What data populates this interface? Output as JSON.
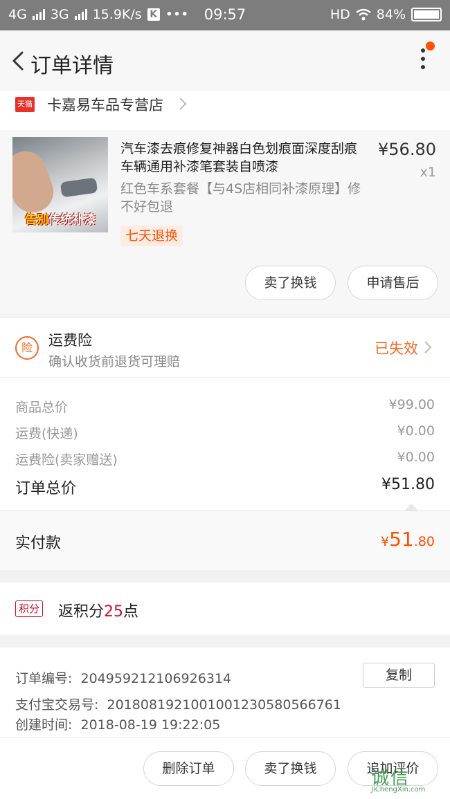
{
  "status_bar": {
    "network1": "4G",
    "network2": "3G",
    "speed": "15.9K/s",
    "k_icon": "K",
    "dots": "•••",
    "time": "09:57",
    "hd": "HD",
    "battery": "84%"
  },
  "header": {
    "title": "订单详情"
  },
  "store": {
    "badge": "天猫",
    "name": "卡嘉易车品专营店"
  },
  "product": {
    "image_banner_a": "告别",
    "image_banner_b": "传统补漆",
    "name": "汽车漆去痕修复神器白色划痕面深度刮痕车辆通用补漆笔套装自喷漆",
    "price": "¥56.80",
    "quantity": "x1",
    "sku": "红色车系套餐【与4S店相同补漆原理】修不好包退",
    "badge": "七天退换",
    "btn_sell": "卖了换钱",
    "btn_aftersale": "申请售后"
  },
  "insurance": {
    "icon_text": "险",
    "title": "运费险",
    "subtitle": "确认收货前退货可理赔",
    "status": "已失效"
  },
  "price": {
    "rows": [
      {
        "label": "商品总价",
        "value": "¥99.00"
      },
      {
        "label": "运费(快递)",
        "value": "¥0.00"
      },
      {
        "label": "运费险(卖家赠送)",
        "value": "¥0.00"
      }
    ],
    "total_label": "订单总价",
    "total_value": "¥51.80",
    "paid_label": "实付款",
    "paid_currency": "¥",
    "paid_int": "51",
    "paid_dec": ".80"
  },
  "points": {
    "tag": "积分",
    "text_prefix": "返积分",
    "count": "25",
    "text_suffix": "点"
  },
  "order_info": {
    "order_no_label": "订单编号:",
    "order_no": "204959212106926314",
    "copy_label": "复制",
    "alipay_label": "支付宝交易号:",
    "alipay_no": "2018081921001001230580566761",
    "created_label": "创建时间:",
    "created_time": "2018-08-19 19:22:05"
  },
  "bottom_bar": {
    "delete_label": "删除订单",
    "sell_label": "卖了换钱",
    "review_label": "追加评价"
  },
  "watermark": {
    "text": "诚信",
    "domain": "JiChengXin.com"
  },
  "colors": {
    "accent": "#ff5000",
    "insurance": "#f06a24",
    "points": "#c8102e"
  }
}
